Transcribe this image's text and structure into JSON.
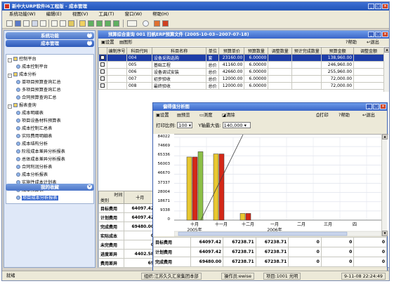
{
  "app": {
    "title": "新中大URP软件i6工程版 - 成本管理"
  },
  "menu": [
    "系统功能(W)",
    "编辑(E)",
    "视图(V)",
    "工具(T)",
    "窗口(W)",
    "帮助(H)"
  ],
  "sidebar": {
    "headers": [
      "系统功能",
      "成本管理",
      "我的收藏"
    ],
    "tree": [
      {
        "label": "控制平台",
        "level": 0,
        "type": "folder",
        "exp": "-"
      },
      {
        "label": "成本控制平台",
        "level": 1,
        "type": "leaf"
      },
      {
        "label": "成本分析",
        "level": 0,
        "type": "folder",
        "exp": "-"
      },
      {
        "label": "单项目预算查询汇总",
        "level": 1,
        "type": "leaf"
      },
      {
        "label": "多项目预算查询汇总",
        "level": 1,
        "type": "leaf"
      },
      {
        "label": "合同预算查询汇总",
        "level": 1,
        "type": "leaf"
      },
      {
        "label": "报表查询",
        "level": 0,
        "type": "folder",
        "exp": "-"
      },
      {
        "label": "成本明细表",
        "level": 1,
        "type": "leaf"
      },
      {
        "label": "项目设备材料预算表",
        "level": 1,
        "type": "leaf"
      },
      {
        "label": "成本控制汇总表",
        "level": 1,
        "type": "leaf"
      },
      {
        "label": "实际费用明细表",
        "level": 1,
        "type": "leaf"
      },
      {
        "label": "成本结构分析",
        "level": 1,
        "type": "leaf"
      },
      {
        "label": "阶段成本差异分析报表",
        "level": 1,
        "type": "leaf"
      },
      {
        "label": "总体成本差异分析报表",
        "level": 1,
        "type": "leaf"
      },
      {
        "label": "合同利润分析表",
        "level": 1,
        "type": "leaf"
      },
      {
        "label": "成本分析报表",
        "level": 1,
        "type": "leaf"
      },
      {
        "label": "实施性成本计划表",
        "level": 1,
        "type": "leaf"
      },
      {
        "label": "成本核算表",
        "level": 1,
        "type": "leaf"
      },
      {
        "label": "项目成本分析报表",
        "level": 1,
        "type": "leaf",
        "selected": true
      }
    ]
  },
  "budget_window": {
    "title": "预算综合查询  001          扫帆ERP预算文件 (2005-10-03~2007-07-18)",
    "toolbar": {
      "settings": "设置",
      "chart": "图形",
      "help": "帮助",
      "exit": "退出"
    },
    "columns": [
      "",
      "编制序号",
      "科目代码",
      "科目名称",
      "单位",
      "预算单价",
      "预算数量",
      "调整数量",
      "预计完成数量",
      "预算金额",
      "调整金额"
    ],
    "rows": [
      {
        "seq": "",
        "code": "004",
        "name": "设备采购选购",
        "unit": "套",
        "price": "23160.00",
        "qty": "6.00000",
        "adj": "",
        "done": "",
        "amount": "138,960.00",
        "adjamt": "",
        "sel": true
      },
      {
        "seq": "",
        "code": "005",
        "name": "基础工程",
        "unit": "总价",
        "price": "41160.00",
        "qty": "6.00000",
        "adj": "",
        "done": "",
        "amount": "246,960.00",
        "adjamt": ""
      },
      {
        "seq": "",
        "code": "006",
        "name": "设备调试安装",
        "unit": "总价",
        "price": "42660.00",
        "qty": "6.00000",
        "adj": "",
        "done": "",
        "amount": "255,960.00",
        "adjamt": ""
      },
      {
        "seq": "",
        "code": "007",
        "name": "初步验收",
        "unit": "总价",
        "price": "12000.00",
        "qty": "6.00000",
        "adj": "",
        "done": "",
        "amount": "72,000.00",
        "adjamt": ""
      },
      {
        "seq": "",
        "code": "008",
        "name": "最终验收",
        "unit": "总价",
        "price": "12000.00",
        "qty": "6.00000",
        "adj": "",
        "done": "",
        "amount": "72,000.00",
        "adjamt": ""
      }
    ]
  },
  "analysis_grid": {
    "corner_top": "时间",
    "corner_bottom": "类别",
    "month": "十月",
    "rows": [
      {
        "label": "目标费用",
        "value": "64097.42"
      },
      {
        "label": "计划费用",
        "value": "64097.42"
      },
      {
        "label": "完成费用",
        "value": "69480.00"
      },
      {
        "label": "实际成本",
        "value": "0"
      },
      {
        "label": "未完费用",
        "value": "0"
      },
      {
        "label": "进度差异",
        "value": "4402.58"
      },
      {
        "label": "费用差异",
        "value": "69"
      }
    ]
  },
  "popup": {
    "title": "偏得值分析图",
    "toolbar": {
      "settings": "设置",
      "preview": "预览",
      "measure": "测度",
      "clear": "清除",
      "print": "打印",
      "help": "帮助",
      "exit": "退出"
    },
    "print_scale_label": "打印比例:",
    "print_scale": "100",
    "ymax_label": "Y轴最大值:",
    "ymax": "140,000",
    "grid": {
      "row_labels": [
        "目标费用",
        "计划费用",
        "完成费用"
      ],
      "cols": [
        {
          "values": [
            "64097.42",
            "64097.42",
            "69480.00"
          ]
        },
        {
          "values": [
            "67238.71",
            "67238.71",
            "67238.71"
          ]
        },
        {
          "values": [
            "67238.71",
            "67238.71",
            "67238.71"
          ]
        },
        {
          "values": [
            "0",
            "0",
            "0"
          ]
        },
        {
          "values": [
            "0",
            "0",
            "0"
          ]
        },
        {
          "values": [
            "0",
            "0",
            "0"
          ]
        }
      ]
    }
  },
  "chart_data": {
    "type": "bar",
    "categories": [
      "十月\n2005年",
      "十一月",
      "十二月",
      "一月\n2006年",
      "二月",
      "三月",
      "四"
    ],
    "yticks": [
      "84022",
      "74669",
      "65336",
      "56003",
      "46670",
      "37337",
      "28004",
      "18671",
      "9338",
      "0"
    ],
    "ylim": [
      0,
      84022
    ],
    "series": [
      {
        "name": "目标费用",
        "color": "#e8c830",
        "values": [
          64097.42,
          67238.71,
          6800,
          0,
          0,
          0,
          0
        ]
      },
      {
        "name": "计划费用",
        "color": "#d42818",
        "values": [
          64097.42,
          67238.71,
          6800,
          0,
          0,
          0,
          0
        ]
      },
      {
        "name": "完成费用",
        "color": "#8cc048",
        "values": [
          69480.0,
          0,
          0,
          0,
          0,
          0,
          0
        ]
      }
    ],
    "line": {
      "color": "#404040"
    }
  },
  "statusbar": {
    "ready": "就绪",
    "org": "组织:江苏久久汇泉集团本部",
    "operator": "操作员:ewise",
    "project": "项目:1001 光明",
    "time": "9-11-08 22:24:49"
  }
}
